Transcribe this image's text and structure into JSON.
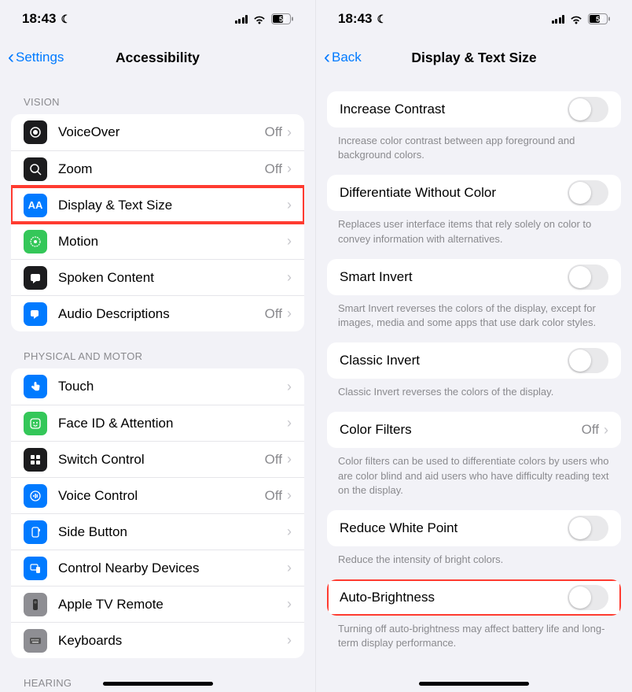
{
  "status": {
    "time": "18:43",
    "battery": "57"
  },
  "left": {
    "back": "Settings",
    "title": "Accessibility",
    "sections": {
      "vision_header": "VISION",
      "physical_header": "PHYSICAL AND MOTOR",
      "hearing_header": "HEARING"
    },
    "rows": {
      "voiceover": {
        "label": "VoiceOver",
        "value": "Off"
      },
      "zoom": {
        "label": "Zoom",
        "value": "Off"
      },
      "display": {
        "label": "Display & Text Size",
        "value": ""
      },
      "motion": {
        "label": "Motion",
        "value": ""
      },
      "spoken": {
        "label": "Spoken Content",
        "value": ""
      },
      "audio": {
        "label": "Audio Descriptions",
        "value": "Off"
      },
      "touch": {
        "label": "Touch",
        "value": ""
      },
      "faceid": {
        "label": "Face ID & Attention",
        "value": ""
      },
      "switch": {
        "label": "Switch Control",
        "value": "Off"
      },
      "voice": {
        "label": "Voice Control",
        "value": "Off"
      },
      "side": {
        "label": "Side Button",
        "value": ""
      },
      "nearby": {
        "label": "Control Nearby Devices",
        "value": ""
      },
      "apple": {
        "label": "Apple TV Remote",
        "value": ""
      },
      "keyboards": {
        "label": "Keyboards",
        "value": ""
      }
    }
  },
  "right": {
    "back": "Back",
    "title": "Display & Text Size",
    "rows": {
      "contrast": {
        "label": "Increase Contrast",
        "footer": "Increase color contrast between app foreground and background colors."
      },
      "diff": {
        "label": "Differentiate Without Color",
        "footer": "Replaces user interface items that rely solely on color to convey information with alternatives."
      },
      "smart": {
        "label": "Smart Invert",
        "footer": "Smart Invert reverses the colors of the display, except for images, media and some apps that use dark color styles."
      },
      "classic": {
        "label": "Classic Invert",
        "footer": "Classic Invert reverses the colors of the display."
      },
      "filters": {
        "label": "Color Filters",
        "value": "Off",
        "footer": "Color filters can be used to differentiate colors by users who are color blind and aid users who have difficulty reading text on the display."
      },
      "white": {
        "label": "Reduce White Point",
        "footer": "Reduce the intensity of bright colors."
      },
      "auto": {
        "label": "Auto-Brightness",
        "footer": "Turning off auto-brightness may affect battery life and long-term display performance."
      }
    }
  }
}
